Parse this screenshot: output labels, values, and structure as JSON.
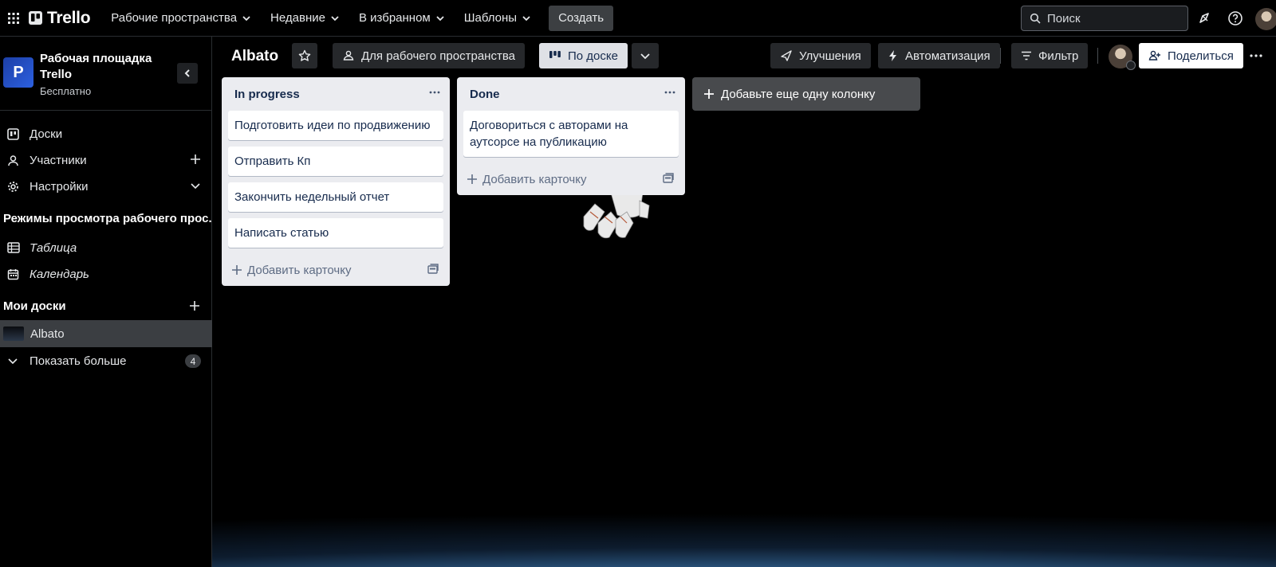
{
  "topbar": {
    "logo_text": "Trello",
    "nav": [
      {
        "label": "Рабочие пространства"
      },
      {
        "label": "Недавние"
      },
      {
        "label": "В избранном"
      },
      {
        "label": "Шаблоны"
      }
    ],
    "create_label": "Создать",
    "search_placeholder": "Поиск"
  },
  "sidebar": {
    "workspace": {
      "badge": "P",
      "name": "Рабочая площадка Trello",
      "plan": "Бесплатно"
    },
    "items": [
      {
        "label": "Доски",
        "icon": "board-icon"
      },
      {
        "label": "Участники",
        "icon": "person-icon"
      },
      {
        "label": "Настройки",
        "icon": "gear-icon"
      }
    ],
    "views_title": "Режимы просмотра рабочего прос...",
    "views": [
      {
        "label": "Таблица",
        "icon": "table-icon"
      },
      {
        "label": "Календарь",
        "icon": "calendar-icon"
      }
    ],
    "my_boards_title": "Мои доски",
    "boards": [
      {
        "label": "Albato"
      }
    ],
    "show_more_label": "Показать больше",
    "show_more_count": "4"
  },
  "board": {
    "title": "Albato",
    "visibility_label": "Для рабочего пространства",
    "view_label": "По доске",
    "powerups_label": "Улучшения",
    "automation_label": "Автоматизация",
    "filter_label": "Фильтр",
    "share_label": "Поделиться",
    "lists": [
      {
        "title": "In progress",
        "cards": [
          "Подготовить идеи по продвижению",
          "Отправить Кп",
          "Закончить недельный отчет",
          "Написать статью"
        ],
        "add_card_label": "Добавить карточку"
      },
      {
        "title": "Done",
        "cards": [
          "Договориться с авторами на аутсорсе на публикацию"
        ],
        "add_card_label": "Добавить карточку"
      }
    ],
    "add_list_label": "Добавьте еще одну колонку"
  },
  "colors": {
    "bg": "#000000",
    "list_bg": "#ebecf0",
    "card_text": "#172b4d",
    "workspace_badge": "#2c60e0"
  }
}
